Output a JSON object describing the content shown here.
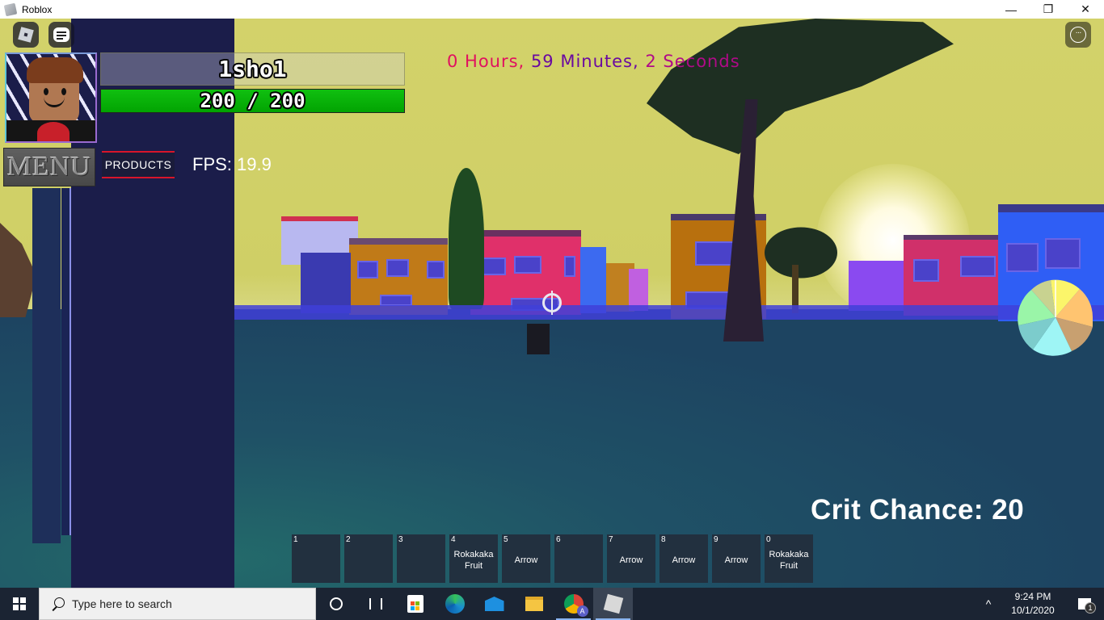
{
  "window": {
    "title": "Roblox",
    "controls": {
      "minimize": "—",
      "restore": "❐",
      "close": "✕"
    }
  },
  "hud": {
    "player_name": "1sho1",
    "health": {
      "current": 200,
      "max": 200,
      "text": "200 / 200",
      "fraction": 1.0
    },
    "menu_label": "MENU",
    "products_label": "PRODUCTS",
    "fps_text": "FPS: 19.9",
    "timer": {
      "hours": "0 Hours,",
      "minutes": "59 Minutes,",
      "seconds": "2 Seconds"
    },
    "crit_text": "Crit Chance: 20",
    "more_icon": "···"
  },
  "hotbar": {
    "slots": [
      {
        "key": "1",
        "item": ""
      },
      {
        "key": "2",
        "item": ""
      },
      {
        "key": "3",
        "item": ""
      },
      {
        "key": "4",
        "item": "Rokakaka Fruit"
      },
      {
        "key": "5",
        "item": "Arrow"
      },
      {
        "key": "6",
        "item": ""
      },
      {
        "key": "7",
        "item": "Arrow"
      },
      {
        "key": "8",
        "item": "Arrow"
      },
      {
        "key": "9",
        "item": "Arrow"
      },
      {
        "key": "0",
        "item": "Rokakaka Fruit"
      }
    ]
  },
  "colors": {
    "health_green": "#02a302",
    "products_accent": "#d8152a",
    "timer_pink": "#e01060",
    "timer_purple": "#6a0aa0"
  },
  "taskbar": {
    "search_placeholder": "Type here to search",
    "apps": [
      "cortana-icon",
      "task-view-icon",
      "store-icon",
      "edge-icon",
      "mail-icon",
      "file-explorer-icon",
      "chrome-icon",
      "roblox-icon"
    ],
    "time": "9:24 PM",
    "date": "10/1/2020",
    "notification_count": "1",
    "tray_chevron": "^"
  }
}
